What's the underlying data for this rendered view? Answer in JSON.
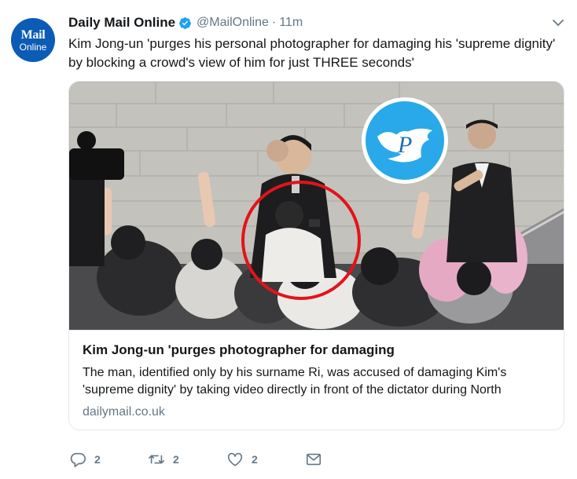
{
  "tweet": {
    "avatar": {
      "line1": "Mail",
      "line2": "Online"
    },
    "display_name": "Daily Mail Online",
    "verified_icon": "verified-badge-icon",
    "handle": "@MailOnline",
    "separator": "·",
    "time": "11m",
    "text": "Kim Jong-un 'purges his personal photographer for damaging his 'supreme dignity' by blocking a crowd's view of him for just THREE seconds'"
  },
  "card": {
    "title": "Kim Jong-un 'purges photographer for damaging",
    "description": "The man, identified only by his surname Ri, was accused of damaging Kim's 'supreme dignity' by taking video directly in front of the dictator during North",
    "domain": "dailymail.co.uk",
    "watermark_letter": "P"
  },
  "actions": {
    "reply_count": "2",
    "retweet_count": "2",
    "like_count": "2"
  },
  "colors": {
    "brand_blue": "#0b5cb5",
    "verified_blue": "#1da1f2",
    "muted": "#657786",
    "circle_red": "#e3131b"
  }
}
